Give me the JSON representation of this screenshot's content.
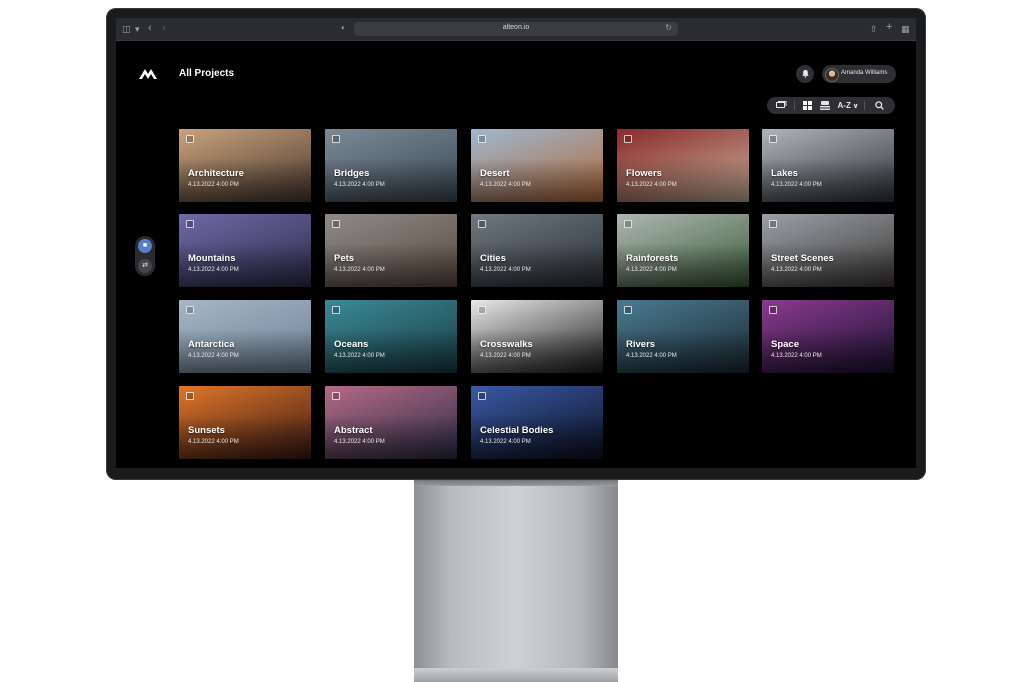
{
  "browser": {
    "url": "alteon.io"
  },
  "header": {
    "title": "All Projects",
    "user_name": "Amanda Williams"
  },
  "toolbar": {
    "sort_label": "A-Z"
  },
  "icons": {
    "logo": "mountain-logo-icon",
    "bell": "bell-icon",
    "search": "search-icon"
  },
  "projects": [
    {
      "name": "Architecture",
      "date": "4.13.2022 4:00 PM",
      "colors": [
        "#c9a27c",
        "#4a3a30"
      ]
    },
    {
      "name": "Bridges",
      "date": "4.13.2022 4:00 PM",
      "colors": [
        "#7c8a98",
        "#3c4a54"
      ]
    },
    {
      "name": "Desert",
      "date": "4.13.2022 4:00 PM",
      "colors": [
        "#9cb8d0",
        "#b56a3a"
      ]
    },
    {
      "name": "Flowers",
      "date": "4.13.2022 4:00 PM",
      "colors": [
        "#8a2a2a",
        "#c8b29a"
      ]
    },
    {
      "name": "Lakes",
      "date": "4.13.2022 4:00 PM",
      "colors": [
        "#aeb6bc",
        "#2c3438"
      ]
    },
    {
      "name": "Mountains",
      "date": "4.13.2022 4:00 PM",
      "colors": [
        "#6d6aa6",
        "#2e2c4a"
      ]
    },
    {
      "name": "Pets",
      "date": "4.13.2022 4:00 PM",
      "colors": [
        "#8e8a86",
        "#5a4a40"
      ]
    },
    {
      "name": "Cities",
      "date": "4.13.2022 4:00 PM",
      "colors": [
        "#6f7880",
        "#2a3036"
      ]
    },
    {
      "name": "Rainforests",
      "date": "4.13.2022 4:00 PM",
      "colors": [
        "#aeb8b0",
        "#3c5a3a"
      ]
    },
    {
      "name": "Street Scenes",
      "date": "4.13.2022 4:00 PM",
      "colors": [
        "#9aa0a6",
        "#3e3a38"
      ]
    },
    {
      "name": "Antarctica",
      "date": "4.13.2022 4:00 PM",
      "colors": [
        "#a6b6c6",
        "#6e8294"
      ]
    },
    {
      "name": "Oceans",
      "date": "4.13.2022 4:00 PM",
      "colors": [
        "#3a8a96",
        "#1a3c44"
      ]
    },
    {
      "name": "Crosswalks",
      "date": "4.13.2022 4:00 PM",
      "colors": [
        "#e8e8e8",
        "#1c1c1c"
      ]
    },
    {
      "name": "Rivers",
      "date": "4.13.2022 4:00 PM",
      "colors": [
        "#4a7a90",
        "#1c2a34"
      ]
    },
    {
      "name": "Space",
      "date": "4.13.2022 4:00 PM",
      "colors": [
        "#8a3a8e",
        "#1a1230"
      ]
    },
    {
      "name": "Sunsets",
      "date": "4.13.2022 4:00 PM",
      "colors": [
        "#e0762a",
        "#3a1a14"
      ]
    },
    {
      "name": "Abstract",
      "date": "4.13.2022 4:00 PM",
      "colors": [
        "#b46a86",
        "#2c2e46"
      ]
    },
    {
      "name": "Celestial Bodies",
      "date": "4.13.2022 4:00 PM",
      "colors": [
        "#3a5aa6",
        "#0c1020"
      ]
    }
  ]
}
